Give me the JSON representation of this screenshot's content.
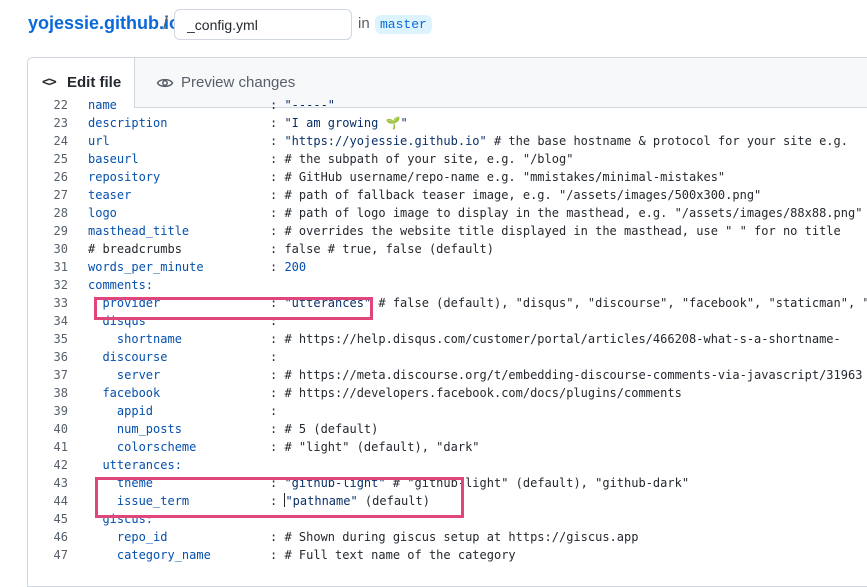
{
  "breadcrumb": {
    "repo": "yojessie.github.io",
    "separator": "/",
    "in_label": "in",
    "branch": "master"
  },
  "file": {
    "name": "_config.yml"
  },
  "tabs": {
    "edit": {
      "label": "Edit file",
      "icon": "code-icon"
    },
    "preview": {
      "label": "Preview changes",
      "icon": "eye-icon"
    }
  },
  "colors": {
    "highlight": "#e0457b",
    "key": "#0550ae",
    "string": "#0a3069",
    "link": "#0969da"
  },
  "lines": [
    {
      "n": "22",
      "key": "name",
      "value": ": \"-----\""
    },
    {
      "n": "23",
      "key": "description",
      "value": ": \"I am growing 🌱\""
    },
    {
      "n": "24",
      "key": "url",
      "value": ": \"https://yojessie.github.io\" # the base hostname & protocol for your site e.g."
    },
    {
      "n": "25",
      "key": "baseurl",
      "value": ": # the subpath of your site, e.g. \"/blog\""
    },
    {
      "n": "26",
      "key": "repository",
      "value": ": # GitHub username/repo-name e.g. \"mmistakes/minimal-mistakes\""
    },
    {
      "n": "27",
      "key": "teaser",
      "value": ": # path of fallback teaser image, e.g. \"/assets/images/500x300.png\""
    },
    {
      "n": "28",
      "key": "logo",
      "value": ": # path of logo image to display in the masthead, e.g. \"/assets/images/88x88.png\""
    },
    {
      "n": "29",
      "key": "masthead_title",
      "value": ": # overrides the website title displayed in the masthead, use \" \" for no title"
    },
    {
      "n": "30",
      "key": "# breadcrumbs",
      "value": ": false # true, false (default)",
      "comment": true
    },
    {
      "n": "31",
      "key": "words_per_minute",
      "value": ": 200"
    },
    {
      "n": "32",
      "key": "comments:",
      "value": ""
    },
    {
      "n": "33",
      "key": "  provider",
      "value": ": \"utterances\" # false (default), \"disqus\", \"discourse\", \"facebook\", \"staticman\", \""
    },
    {
      "n": "34",
      "key": "  disqus",
      "value": ":"
    },
    {
      "n": "35",
      "key": "    shortname",
      "value": ": # https://help.disqus.com/customer/portal/articles/466208-what-s-a-shortname-"
    },
    {
      "n": "36",
      "key": "  discourse",
      "value": ":"
    },
    {
      "n": "37",
      "key": "    server",
      "value": ": # https://meta.discourse.org/t/embedding-discourse-comments-via-javascript/31963"
    },
    {
      "n": "38",
      "key": "  facebook",
      "value": ": # https://developers.facebook.com/docs/plugins/comments"
    },
    {
      "n": "39",
      "key": "    appid",
      "value": ":"
    },
    {
      "n": "40",
      "key": "    num_posts",
      "value": ": # 5 (default)"
    },
    {
      "n": "41",
      "key": "    colorscheme",
      "value": ": # \"light\" (default), \"dark\""
    },
    {
      "n": "42",
      "key": "  utterances:",
      "value": ""
    },
    {
      "n": "43",
      "key": "    theme",
      "value": ": \"github-light\" # \"github-light\" (default), \"github-dark\""
    },
    {
      "n": "44",
      "key": "    issue_term",
      "value": ": \"pathname\" (default)",
      "caret": true
    },
    {
      "n": "45",
      "key": "  giscus:",
      "value": ""
    },
    {
      "n": "46",
      "key": "    repo_id",
      "value": ": # Shown during giscus setup at https://giscus.app"
    },
    {
      "n": "47",
      "key": "    category_name",
      "value": ": # Full text name of the category"
    }
  ]
}
